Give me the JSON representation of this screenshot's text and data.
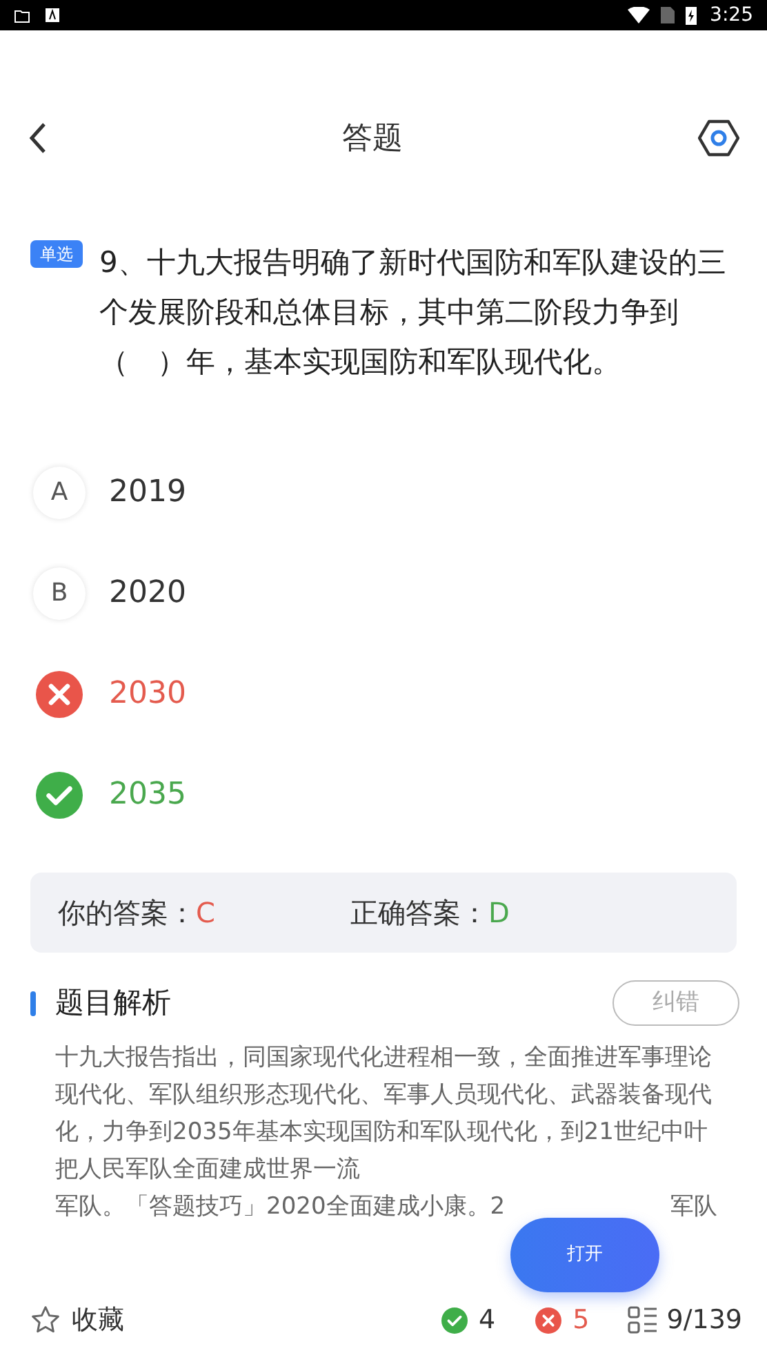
{
  "status_bar": {
    "time": "3:25"
  },
  "header": {
    "title": "答题"
  },
  "question": {
    "type_tag": "单选",
    "text": "9、十九大报告明确了新时代国防和军队建设的三个发展阶段和总体目标，其中第二阶段力争到（　）年，基本实现国防和军队现代化。"
  },
  "options": [
    {
      "letter": "A",
      "text": "2019",
      "kind": "plain"
    },
    {
      "letter": "B",
      "text": "2020",
      "kind": "plain"
    },
    {
      "text": "2030",
      "kind": "wrong"
    },
    {
      "text": "2035",
      "kind": "right"
    }
  ],
  "answer_box": {
    "your_label": "你的答案：",
    "your_value": "C",
    "correct_label": "正确答案：",
    "correct_value": "D"
  },
  "analysis": {
    "title": "题目解析",
    "report_button": "纠错",
    "text": "十九大报告指出，同国家现代化进程相一致，全面推进军事理论现代化、军队组织形态现代化、军事人员现代化、武器装备现代化，力争到2035年基本实现国防和军队现代化，到21世纪中叶把人民军队全面建成世界一流",
    "last_line": "军队。「答题技巧」2020全面建成小康。2",
    "last_line_tail": "军队"
  },
  "floating_button": "打开",
  "footer": {
    "favorite": "收藏",
    "correct_count": "4",
    "wrong_count": "5",
    "progress": "9/139"
  }
}
